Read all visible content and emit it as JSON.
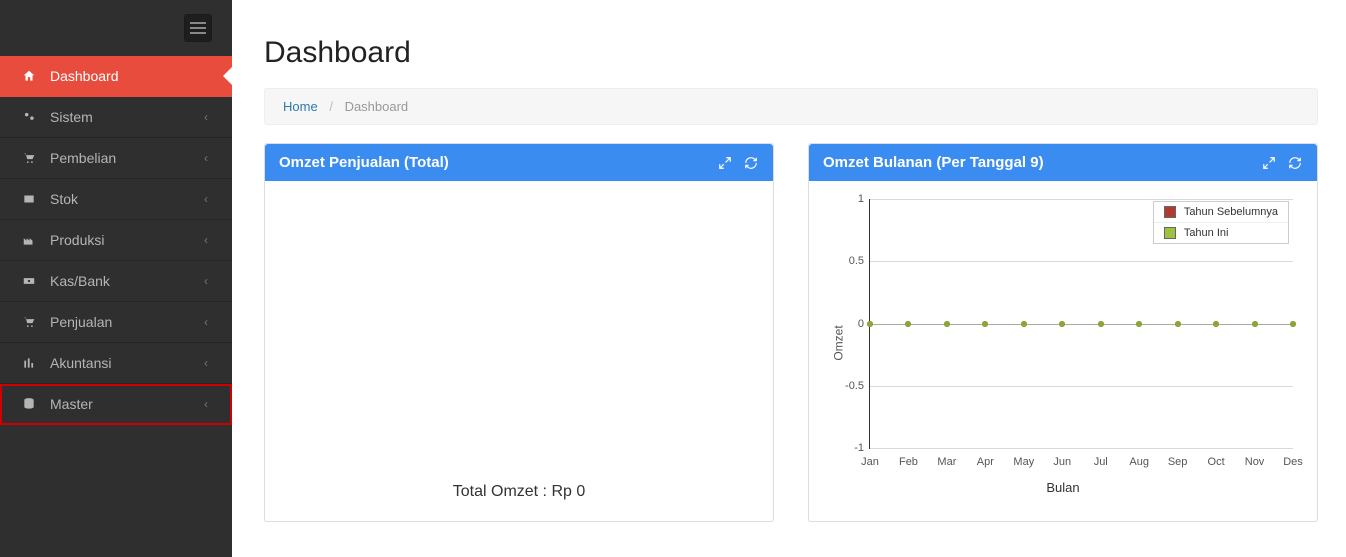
{
  "sidebar": {
    "items": [
      {
        "label": "Dashboard",
        "icon": "home",
        "active": true,
        "hasChildren": false
      },
      {
        "label": "Sistem",
        "icon": "cogs",
        "active": false,
        "hasChildren": true
      },
      {
        "label": "Pembelian",
        "icon": "cart",
        "active": false,
        "hasChildren": true
      },
      {
        "label": "Stok",
        "icon": "box",
        "active": false,
        "hasChildren": true
      },
      {
        "label": "Produksi",
        "icon": "factory",
        "active": false,
        "hasChildren": true
      },
      {
        "label": "Kas/Bank",
        "icon": "cash",
        "active": false,
        "hasChildren": true
      },
      {
        "label": "Penjualan",
        "icon": "cart",
        "active": false,
        "hasChildren": true
      },
      {
        "label": "Akuntansi",
        "icon": "barchart",
        "active": false,
        "hasChildren": true
      },
      {
        "label": "Master",
        "icon": "database",
        "active": false,
        "hasChildren": true,
        "highlighted": true
      }
    ]
  },
  "page": {
    "title": "Dashboard",
    "breadcrumb": {
      "home": "Home",
      "current": "Dashboard"
    }
  },
  "panels": {
    "total": {
      "title": "Omzet Penjualan (Total)",
      "footer": "Total Omzet : Rp 0"
    },
    "monthly": {
      "title": "Omzet Bulanan (Per Tanggal 9)"
    }
  },
  "chart_data": {
    "type": "line",
    "xlabel": "Bulan",
    "ylabel": "Omzet",
    "categories": [
      "Jan",
      "Feb",
      "Mar",
      "Apr",
      "May",
      "Jun",
      "Jul",
      "Aug",
      "Sep",
      "Oct",
      "Nov",
      "Des"
    ],
    "yticks": [
      1,
      0.5,
      0,
      -0.5,
      -1
    ],
    "ylim": [
      -1,
      1
    ],
    "series": [
      {
        "name": "Tahun Sebelumnya",
        "color": "#b23a2e",
        "values": [
          0,
          0,
          0,
          0,
          0,
          0,
          0,
          0,
          0,
          0,
          0,
          0
        ]
      },
      {
        "name": "Tahun Ini",
        "color": "#a0c040",
        "values": [
          0,
          0,
          0,
          0,
          0,
          0,
          0,
          0,
          0,
          0,
          0,
          0
        ]
      }
    ]
  }
}
